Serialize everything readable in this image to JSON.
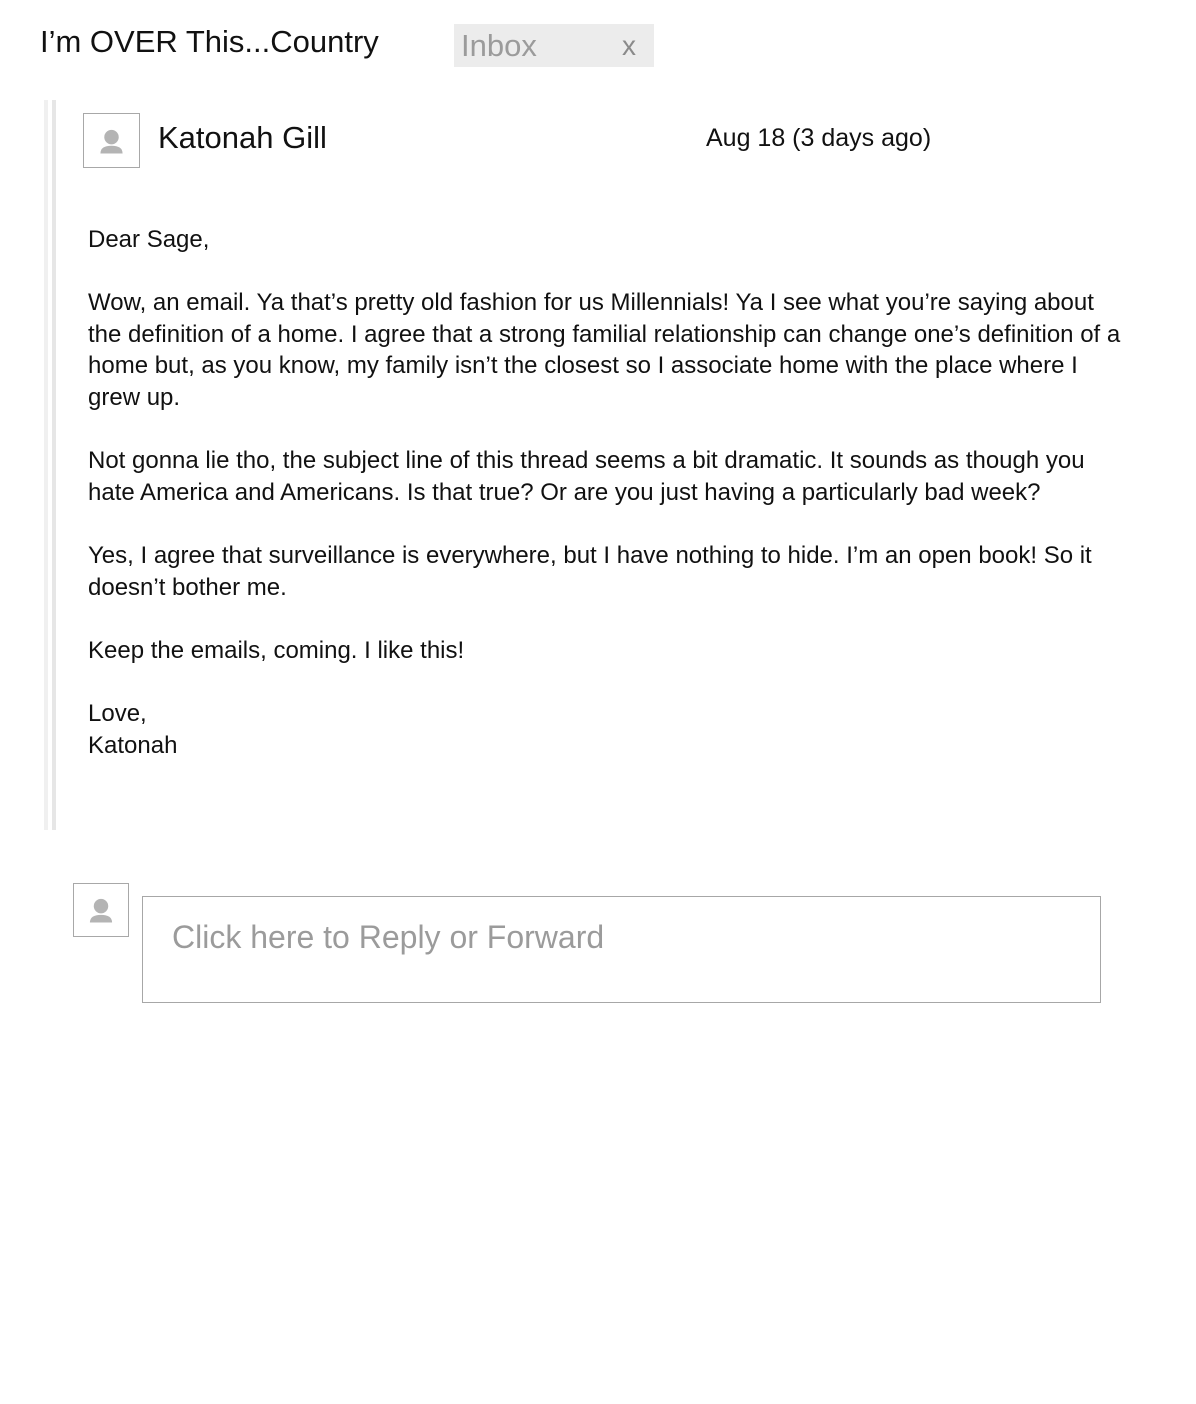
{
  "thread": {
    "subject": "I’m OVER This...Country",
    "label": {
      "text": "Inbox",
      "remove_glyph": "x"
    }
  },
  "message": {
    "sender": "Katonah Gill",
    "date": "Aug 18 (3 days ago)",
    "avatar_icon": "person-placeholder-icon",
    "body": {
      "greeting": "Dear Sage,",
      "paragraphs": [
        "Wow, an email. Ya that’s pretty old fashion for us Millennials! Ya I see what you’re saying about the definition of a home. I agree that a strong familial relationship can change one’s definition of a home but, as you know, my family isn’t the closest so I associate home with the place where I grew up.",
        "Not gonna lie tho, the subject line of this thread seems a bit dramatic. It sounds as though you hate America and Americans. Is that true? Or are you just having a particularly bad week?",
        "Yes, I agree that surveillance is everywhere, but I have nothing to hide. I’m an open book! So it doesn’t bother me.",
        "Keep the emails, coming. I like this!"
      ],
      "closing": "Love,",
      "signature": "Katonah"
    }
  },
  "reply": {
    "placeholder": "Click here to Reply or Forward",
    "avatar_icon": "person-placeholder-icon"
  },
  "colors": {
    "text": "#111111",
    "muted_text": "#9b9b9b",
    "chip_background": "#ececec",
    "border": "#a8a8a8",
    "avatar_glyph": "#b4b4b4"
  }
}
